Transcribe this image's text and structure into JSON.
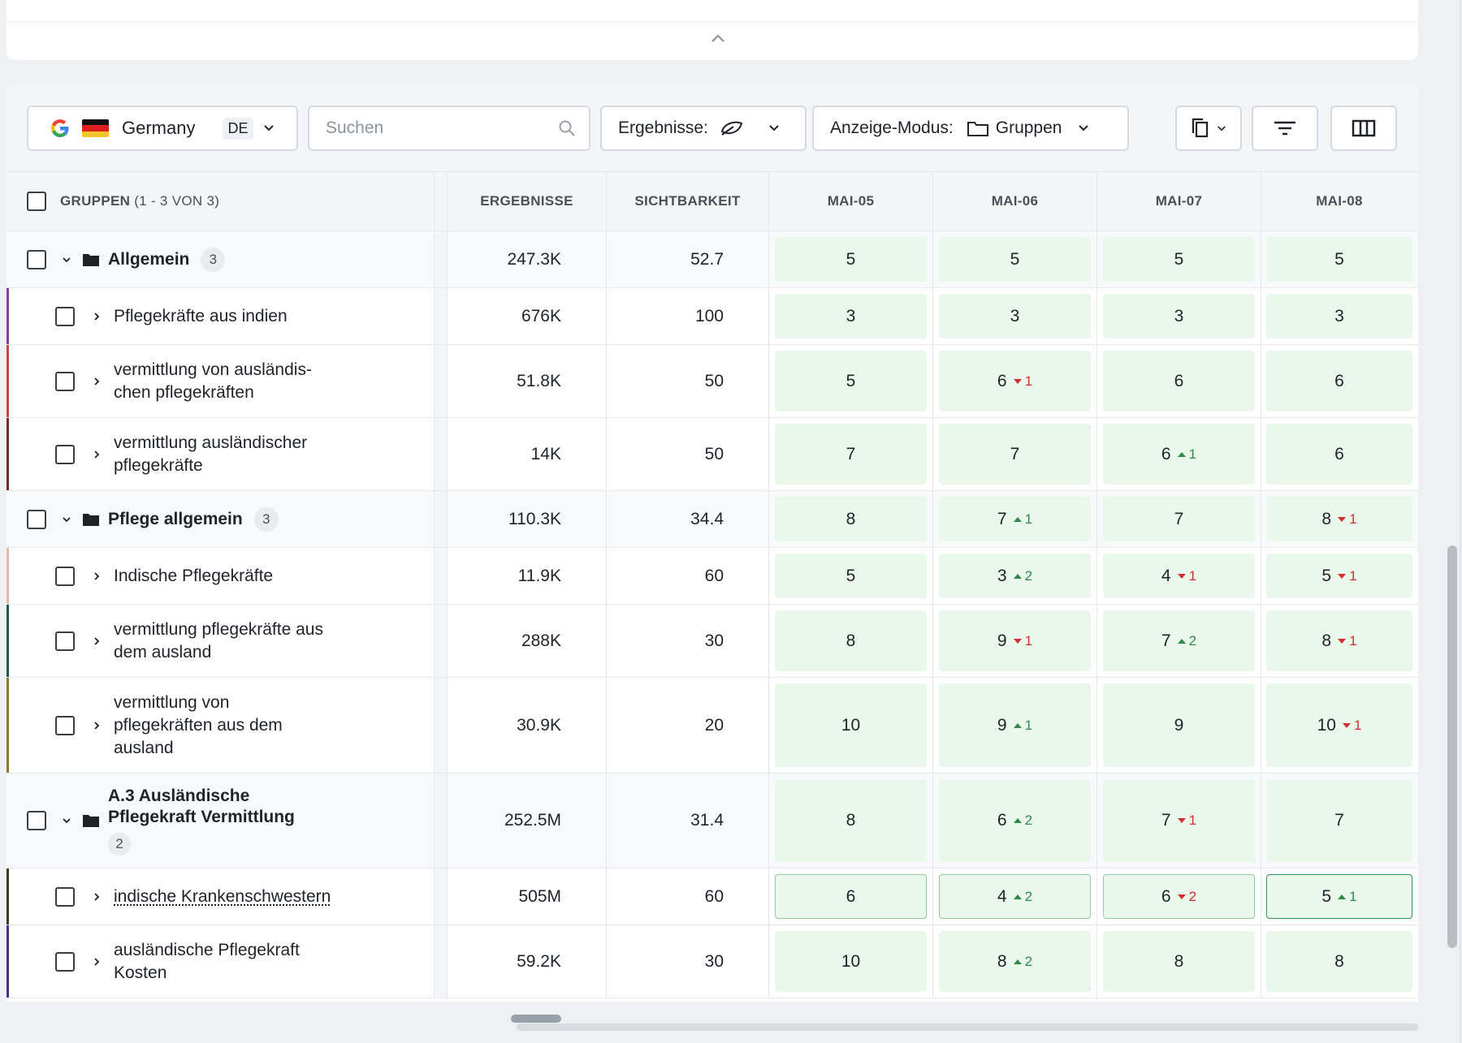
{
  "toolbar": {
    "country": "Germany",
    "country_code": "DE",
    "search_placeholder": "Suchen",
    "results_label": "Ergebnisse:",
    "mode_label": "Anzeige-Modus:",
    "mode_value": "Gruppen"
  },
  "header": {
    "groups_label": "GRUPPEN",
    "groups_count": "(1 - 3 VON 3)",
    "col_results": "ERGEBNISSE",
    "col_visibility": "SICHTBARKEIT",
    "dates": [
      "MAI-05",
      "MAI-06",
      "MAI-07",
      "MAI-08"
    ]
  },
  "colors": {
    "positive": "#2f8a48",
    "negative": "#d12f2f",
    "cell_bg": "#e9f8eb"
  },
  "rows": [
    {
      "type": "group",
      "name": "Allgemein",
      "count": "3",
      "results": "247.3K",
      "visibility": "52.7",
      "positions": [
        {
          "v": "5"
        },
        {
          "v": "5"
        },
        {
          "v": "5"
        },
        {
          "v": "5"
        }
      ]
    },
    {
      "type": "item",
      "name": "Pflegekräfte aus indien",
      "results": "676K",
      "visibility": "100",
      "stripe": "#8e3aa6",
      "positions": [
        {
          "v": "3"
        },
        {
          "v": "3"
        },
        {
          "v": "3"
        },
        {
          "v": "3"
        }
      ]
    },
    {
      "type": "item",
      "name": "vermittlung von ausländis-\nchen pflegekräften",
      "results": "51.8K",
      "visibility": "50",
      "stripe": "#c8473a",
      "positions": [
        {
          "v": "5"
        },
        {
          "v": "6",
          "c": "1",
          "d": "down"
        },
        {
          "v": "6"
        },
        {
          "v": "6"
        }
      ]
    },
    {
      "type": "item",
      "name": "vermittlung ausländischer\npflegekräfte",
      "results": "14K",
      "visibility": "50",
      "stripe": "#7a2a22",
      "positions": [
        {
          "v": "7"
        },
        {
          "v": "7"
        },
        {
          "v": "6",
          "c": "1",
          "d": "up"
        },
        {
          "v": "6"
        }
      ]
    },
    {
      "type": "group",
      "name": "Pflege allgemein",
      "count": "3",
      "results": "110.3K",
      "visibility": "34.4",
      "positions": [
        {
          "v": "8"
        },
        {
          "v": "7",
          "c": "1",
          "d": "up"
        },
        {
          "v": "7"
        },
        {
          "v": "8",
          "c": "1",
          "d": "down"
        }
      ]
    },
    {
      "type": "item",
      "name": "Indische Pflegekräfte",
      "results": "11.9K",
      "visibility": "60",
      "stripe": "#e6b8a6",
      "positions": [
        {
          "v": "5"
        },
        {
          "v": "3",
          "c": "2",
          "d": "up"
        },
        {
          "v": "4",
          "c": "1",
          "d": "down"
        },
        {
          "v": "5",
          "c": "1",
          "d": "down"
        }
      ]
    },
    {
      "type": "item",
      "name": "vermittlung pflegekräfte aus\ndem ausland",
      "results": "288K",
      "visibility": "30",
      "stripe": "#1f5a44",
      "positions": [
        {
          "v": "8"
        },
        {
          "v": "9",
          "c": "1",
          "d": "down"
        },
        {
          "v": "7",
          "c": "2",
          "d": "up"
        },
        {
          "v": "8",
          "c": "1",
          "d": "down"
        }
      ]
    },
    {
      "type": "item",
      "name": "vermittlung von\npflegekräften aus dem\nausland",
      "results": "30.9K",
      "visibility": "20",
      "stripe": "#8c7a2a",
      "positions": [
        {
          "v": "10"
        },
        {
          "v": "9",
          "c": "1",
          "d": "up"
        },
        {
          "v": "9"
        },
        {
          "v": "10",
          "c": "1",
          "d": "down"
        }
      ]
    },
    {
      "type": "group",
      "name": "A.3 Ausländische\nPflegekraft Vermittlung",
      "count": "2",
      "results": "252.5M",
      "visibility": "31.4",
      "positions": [
        {
          "v": "8"
        },
        {
          "v": "6",
          "c": "2",
          "d": "up"
        },
        {
          "v": "7",
          "c": "1",
          "d": "down"
        },
        {
          "v": "7"
        }
      ]
    },
    {
      "type": "item",
      "name": "indische Krankenschwestern",
      "results": "505M",
      "visibility": "60",
      "stripe": "#3d3a1a",
      "underline": true,
      "highlight": true,
      "positions": [
        {
          "v": "6"
        },
        {
          "v": "4",
          "c": "2",
          "d": "up"
        },
        {
          "v": "6",
          "c": "2",
          "d": "down"
        },
        {
          "v": "5",
          "c": "1",
          "d": "up"
        }
      ]
    },
    {
      "type": "item",
      "name": "ausländische Pflegekraft\nKosten",
      "results": "59.2K",
      "visibility": "30",
      "stripe": "#4b2e8c",
      "positions": [
        {
          "v": "10"
        },
        {
          "v": "8",
          "c": "2",
          "d": "up"
        },
        {
          "v": "8"
        },
        {
          "v": "8"
        }
      ]
    }
  ]
}
